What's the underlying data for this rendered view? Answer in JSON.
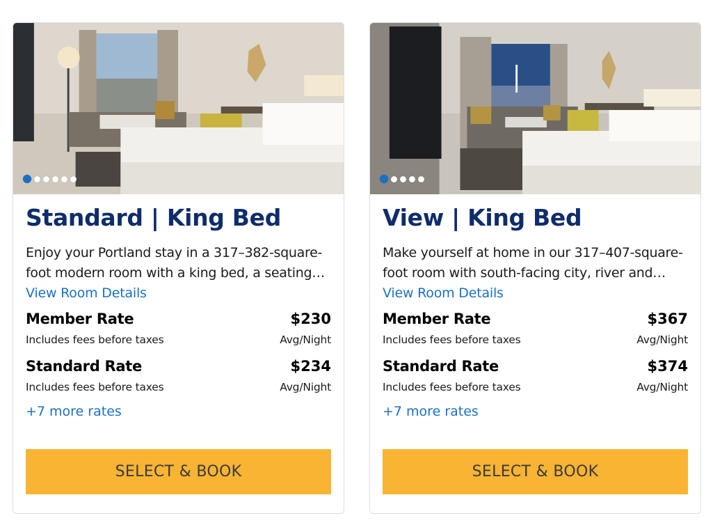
{
  "rooms": [
    {
      "title": "Standard | King Bed",
      "description_line1": "Enjoy your Portland stay in a 317–382-square-",
      "description_line2": "foot modern room with a king bed, a seating…",
      "details_link": "View Room Details",
      "photo_count": 6,
      "active_photo": 0,
      "rates": [
        {
          "name": "Member Rate",
          "price": "$230",
          "note": "Includes fees before taxes",
          "unit": "Avg/Night"
        },
        {
          "name": "Standard Rate",
          "price": "$234",
          "note": "Includes fees before taxes",
          "unit": "Avg/Night"
        }
      ],
      "more_rates": "+7 more rates",
      "book_label": "SELECT & BOOK"
    },
    {
      "title": "View | King Bed",
      "description_line1": "Make yourself at home in our 317–407-square-",
      "description_line2": "foot room with south-facing city, river and…",
      "details_link": "View Room Details",
      "photo_count": 5,
      "active_photo": 0,
      "rates": [
        {
          "name": "Member Rate",
          "price": "$367",
          "note": "Includes fees before taxes",
          "unit": "Avg/Night"
        },
        {
          "name": "Standard Rate",
          "price": "$374",
          "note": "Includes fees before taxes",
          "unit": "Avg/Night"
        }
      ],
      "more_rates": "+7 more rates",
      "book_label": "SELECT & BOOK"
    }
  ],
  "colors": {
    "title": "#0f2c6b",
    "link": "#1a6fc9",
    "button": "#f9b433",
    "active_dot": "#1a6fc9"
  }
}
